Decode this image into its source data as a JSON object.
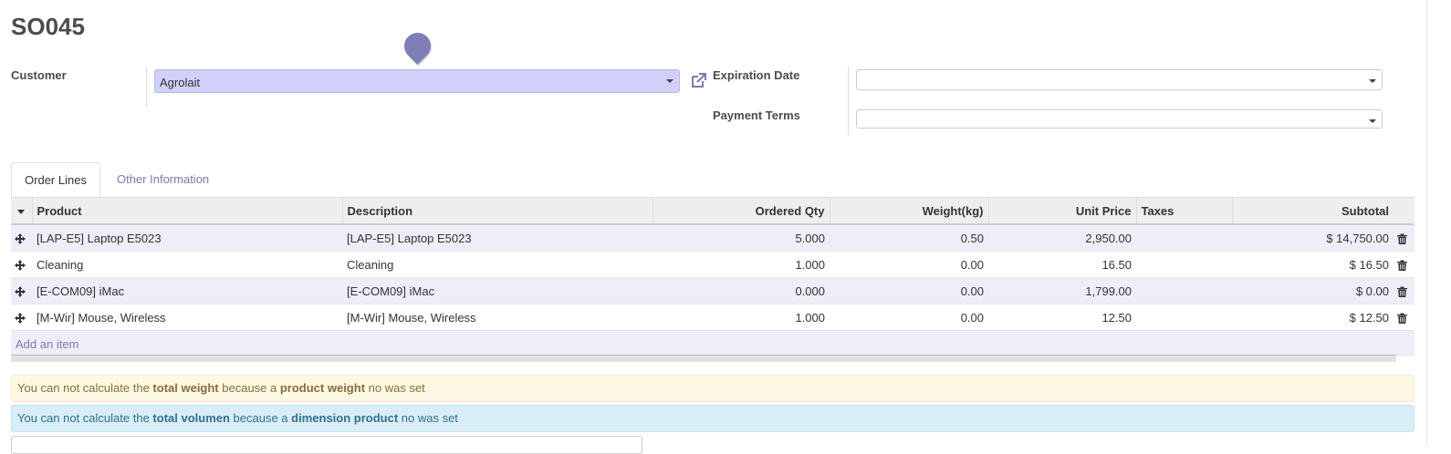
{
  "record": {
    "title": "SO045"
  },
  "form": {
    "customer_label": "Customer",
    "customer_value": "Agrolait",
    "expiration_label": "Expiration Date",
    "expiration_value": "",
    "payment_terms_label": "Payment Terms",
    "payment_terms_value": ""
  },
  "tabs": [
    {
      "label": "Order Lines",
      "active": true
    },
    {
      "label": "Other Information",
      "active": false
    }
  ],
  "table": {
    "headers": {
      "product": "Product",
      "description": "Description",
      "ordered_qty": "Ordered Qty",
      "weight": "Weight(kg)",
      "unit_price": "Unit Price",
      "taxes": "Taxes",
      "subtotal": "Subtotal"
    },
    "rows": [
      {
        "product": "[LAP-E5] Laptop E5023",
        "description": "[LAP-E5] Laptop E5023",
        "ordered_qty": "5.000",
        "weight": "0.50",
        "unit_price": "2,950.00",
        "taxes": "",
        "subtotal": "$ 14,750.00"
      },
      {
        "product": "Cleaning",
        "description": "Cleaning",
        "ordered_qty": "1.000",
        "weight": "0.00",
        "unit_price": "16.50",
        "taxes": "",
        "subtotal": "$ 16.50"
      },
      {
        "product": "[E-COM09] iMac",
        "description": "[E-COM09] iMac",
        "ordered_qty": "0.000",
        "weight": "0.00",
        "unit_price": "1,799.00",
        "taxes": "",
        "subtotal": "$ 0.00"
      },
      {
        "product": "[M-Wir] Mouse, Wireless",
        "description": "[M-Wir] Mouse, Wireless",
        "ordered_qty": "1.000",
        "weight": "0.00",
        "unit_price": "12.50",
        "taxes": "",
        "subtotal": "$ 12.50"
      }
    ],
    "add_item": "Add an item"
  },
  "alerts": {
    "weight": {
      "p1": "You can not calculate the ",
      "b1": "total weight",
      "p2": " because a ",
      "b2": "product weight",
      "p3": " no was set"
    },
    "volume": {
      "p1": "You can not calculate the ",
      "b1": "total volumen",
      "p2": " because a ",
      "b2": "dimension product",
      "p3": " no was set"
    }
  },
  "colors": {
    "accent": "#7c7bad",
    "selected_field": "#d0d0fb",
    "warning_bg": "#fcf8e3",
    "info_bg": "#d9edf7"
  },
  "icons": {
    "marker": "map-pin-icon",
    "external": "external-link-icon",
    "sort": "caret-down-icon",
    "drag": "move-arrows-icon",
    "delete": "trash-icon"
  }
}
